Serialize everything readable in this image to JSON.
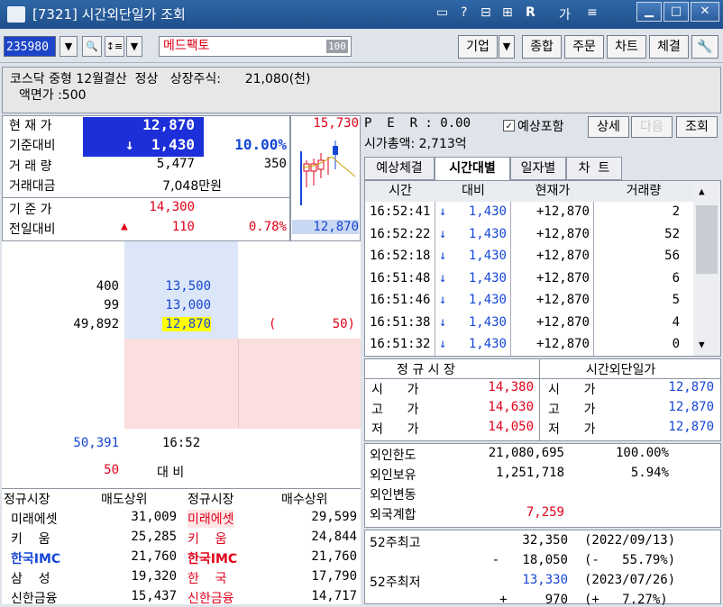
{
  "window": {
    "title": "[7321] 시간외단일가 조회",
    "icons": [
      "▭",
      "?",
      "⊟",
      "⊞",
      "R",
      "가",
      "≡"
    ]
  },
  "toolbar": {
    "code": "235980",
    "name": "메드팩토",
    "badge": "100",
    "buttons": [
      "기업",
      "종합",
      "주문",
      "차트",
      "체결"
    ]
  },
  "info": {
    "line1": "코스닥 중형 12월결산  정상   상장주식:      21,080(천)",
    "line2": "액면가 :500"
  },
  "quote": {
    "rows": [
      {
        "label": "현 재 가",
        "value": "12,870",
        "extra": ""
      },
      {
        "label": "기준대비",
        "value": "↓  1,430",
        "extra": "10.00%"
      },
      {
        "label": "거 래 량",
        "value": "5,477",
        "extra": "350"
      },
      {
        "label": "거래대금",
        "value": "7,048만원",
        "extra": ""
      },
      {
        "label": "기 준 가",
        "value": "14,300",
        "extra": ""
      },
      {
        "label": "전일대비",
        "value": "110",
        "extra": "0.78%"
      }
    ],
    "up_arrow": "▲",
    "mini_high": "15,730",
    "mini_low": "12,870"
  },
  "orderbook": {
    "asks": [
      {
        "qty": "400",
        "price": "13,500"
      },
      {
        "qty": "99",
        "price": "13,000"
      },
      {
        "qty": "49,892",
        "price": "12,870"
      }
    ],
    "paren_left": "(",
    "paren_right": "50)",
    "total_ask": "50,391",
    "time": "16:52",
    "total_bid": "50",
    "bid_label": "대 비"
  },
  "broker": {
    "headers": [
      "정규시장",
      "매도상위",
      "정규시장",
      "매수상위"
    ],
    "rows": [
      {
        "a": "미래에셋",
        "b": "31,009",
        "c": "미래에셋",
        "d": "29,599"
      },
      {
        "a": "키    움",
        "b": "25,285",
        "c": "키    움",
        "d": "24,844"
      },
      {
        "a": "한국IMC",
        "b": "21,760",
        "c": "한국IMC",
        "d": "21,760"
      },
      {
        "a": "삼    성",
        "b": "19,320",
        "c": "한    국",
        "d": "17,790"
      },
      {
        "a": "신한금융",
        "b": "15,437",
        "c": "신한금융",
        "d": "14,717"
      }
    ]
  },
  "right": {
    "per": "P  E  R : 0.00",
    "cap": "시가총액: 2,713억",
    "checkbox": "예상포함",
    "btn_detail": "상세",
    "btn_next": "다음",
    "btn_query": "조회",
    "tabs": [
      "예상체결",
      "시간대별",
      "일자별",
      "차  트"
    ],
    "table_headers": [
      "시간",
      "대비",
      "현재가",
      "거래량"
    ],
    "trades": [
      {
        "time": "16:52:41",
        "arrow": "↓",
        "diff": "1,430",
        "price": "+12,870",
        "vol": "2"
      },
      {
        "time": "16:52:22",
        "arrow": "↓",
        "diff": "1,430",
        "price": "+12,870",
        "vol": "52"
      },
      {
        "time": "16:52:18",
        "arrow": "↓",
        "diff": "1,430",
        "price": "+12,870",
        "vol": "56"
      },
      {
        "time": "16:51:48",
        "arrow": "↓",
        "diff": "1,430",
        "price": "+12,870",
        "vol": "6"
      },
      {
        "time": "16:51:46",
        "arrow": "↓",
        "diff": "1,430",
        "price": "+12,870",
        "vol": "5"
      },
      {
        "time": "16:51:38",
        "arrow": "↓",
        "diff": "1,430",
        "price": "+12,870",
        "vol": "4"
      },
      {
        "time": "16:51:32",
        "arrow": "↓",
        "diff": "1,430",
        "price": "+12,870",
        "vol": "0"
      }
    ],
    "session_headers": [
      "정 규 시 장",
      "시간외단일가"
    ],
    "session": [
      {
        "l": "시      가",
        "v1": "14,380",
        "l2": "시      가",
        "v2": "12,870"
      },
      {
        "l": "고      가",
        "v1": "14,630",
        "l2": "고      가",
        "v2": "12,870"
      },
      {
        "l": "저      가",
        "v1": "14,050",
        "l2": "저      가",
        "v2": "12,870"
      }
    ],
    "foreign": [
      {
        "l": "외인한도",
        "v": "21,080,695",
        "p": "100.00%"
      },
      {
        "l": "외인보유",
        "v": "1,251,718",
        "p": "5.94%"
      },
      {
        "l": "외인변동",
        "v": "",
        "p": ""
      },
      {
        "l": "외국계합",
        "v": "7,259",
        "p": ""
      }
    ],
    "w52": [
      {
        "l": "52주최고",
        "v": "32,350",
        "d": "(2022/09/13)"
      },
      {
        "l": "",
        "v": "-   18,050",
        "d": "(-   55.79%)"
      },
      {
        "l": "52주최저",
        "v": "13,330",
        "d": "(2023/07/26)"
      },
      {
        "l": "",
        "v": "+     970",
        "d": "(+   7.27%)"
      }
    ]
  }
}
